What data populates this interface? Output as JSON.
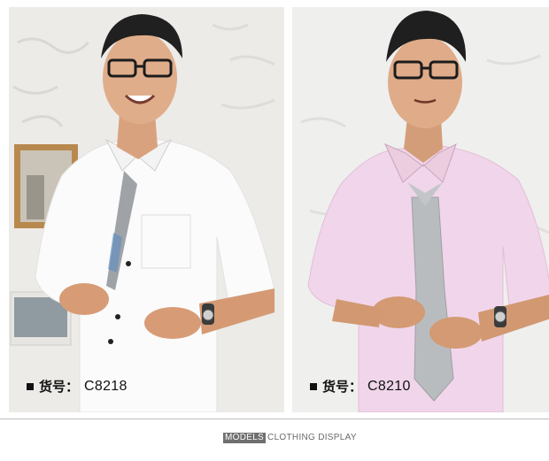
{
  "products": [
    {
      "label_prefix": "货号：",
      "code": "C8218",
      "shirt_color": "#fbfbfb",
      "tie_color": "#9fa3a8"
    },
    {
      "label_prefix": "货号：",
      "code": "C8210",
      "shirt_color": "#f1d5ea",
      "tie_color": "#b9bcbf"
    }
  ],
  "footer": {
    "models": "MODELS",
    "display": "CLOTHING DISPLAY"
  }
}
